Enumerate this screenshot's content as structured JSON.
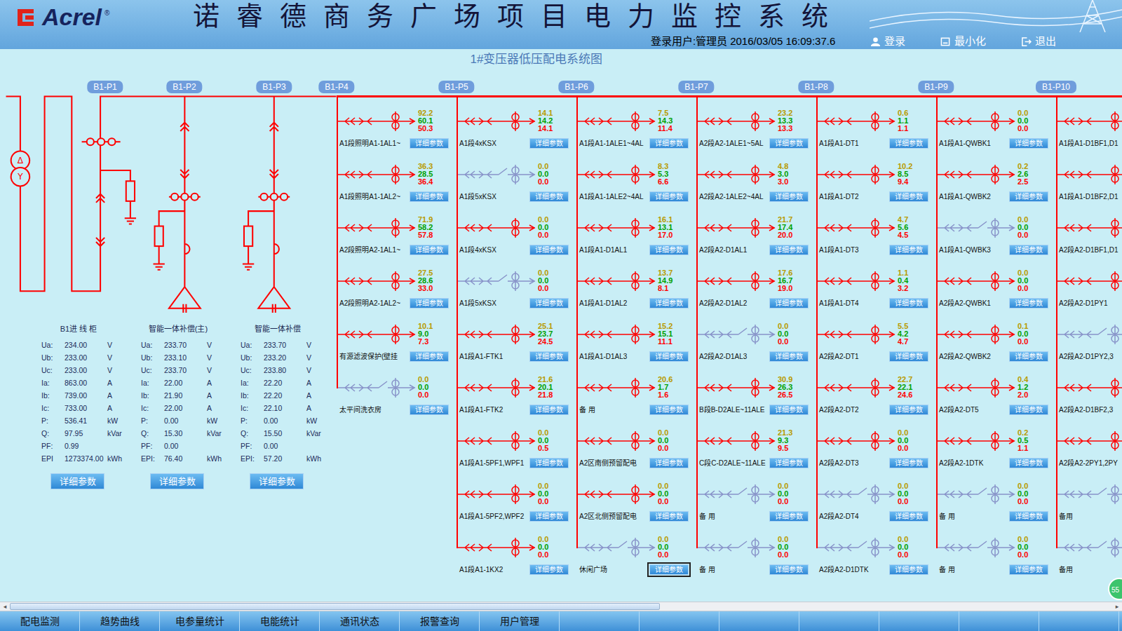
{
  "header": {
    "logo": "Acrel",
    "logo_mark": "®",
    "title": "诺睿德商务广场项目电力监控系统",
    "user": "登录用户:管理员",
    "time": "2016/03/05 16:09:37.6",
    "buttons": [
      {
        "label": "登录"
      },
      {
        "label": "最小化"
      },
      {
        "label": "退出"
      }
    ]
  },
  "diagram": {
    "title": "1#变压器低压配电系统图",
    "transformer": {
      "primary": "Δ",
      "secondary": "Y"
    },
    "cabinets": [
      {
        "tag": "B1-P1",
        "title": "B1进 线 柜",
        "params": [
          {
            "label": "Ua:",
            "value": "234.00",
            "unit": "V"
          },
          {
            "label": "Ub:",
            "value": "233.00",
            "unit": "V"
          },
          {
            "label": "Uc:",
            "value": "233.00",
            "unit": "V"
          },
          {
            "label": "Ia:",
            "value": "863.00",
            "unit": "A"
          },
          {
            "label": "Ib:",
            "value": "739.00",
            "unit": "A"
          },
          {
            "label": "Ic:",
            "value": "733.00",
            "unit": "A"
          },
          {
            "label": "P:",
            "value": "536.41",
            "unit": "kW"
          },
          {
            "label": "Q:",
            "value": "97.95",
            "unit": "kVar"
          },
          {
            "label": "PF:",
            "value": "0.99"
          },
          {
            "label": "EPI",
            "value": "1273374.00",
            "unit": "kWh"
          }
        ]
      },
      {
        "tag": "B1-P2",
        "title": "智能一体补偿(主)",
        "params": [
          {
            "label": "Ua:",
            "value": "233.70",
            "unit": "V"
          },
          {
            "label": "Ub:",
            "value": "233.10",
            "unit": "V"
          },
          {
            "label": "Uc:",
            "value": "233.70",
            "unit": "V"
          },
          {
            "label": "Ia:",
            "value": "22.00",
            "unit": "A"
          },
          {
            "label": "Ib:",
            "value": "21.90",
            "unit": "A"
          },
          {
            "label": "Ic:",
            "value": "22.00",
            "unit": "A"
          },
          {
            "label": "P:",
            "value": "0.00",
            "unit": "kW"
          },
          {
            "label": "Q:",
            "value": "15.30",
            "unit": "kVar"
          },
          {
            "label": "PF:",
            "value": "0.00"
          },
          {
            "label": "EPI:",
            "value": "76.40",
            "unit": "kWh"
          }
        ]
      },
      {
        "tag": "B1-P3",
        "title": "智能一体补偿",
        "params": [
          {
            "label": "Ua:",
            "value": "233.70",
            "unit": "V"
          },
          {
            "label": "Ub:",
            "value": "233.20",
            "unit": "V"
          },
          {
            "label": "Uc:",
            "value": "233.80",
            "unit": "V"
          },
          {
            "label": "Ia:",
            "value": "22.20",
            "unit": "A"
          },
          {
            "label": "Ib:",
            "value": "22.20",
            "unit": "A"
          },
          {
            "label": "Ic:",
            "value": "22.10",
            "unit": "A"
          },
          {
            "label": "P:",
            "value": "0.00",
            "unit": "kW"
          },
          {
            "label": "Q:",
            "value": "15.50",
            "unit": "kVar"
          },
          {
            "label": "PF:",
            "value": "0.00"
          },
          {
            "label": "EPI:",
            "value": "57.20",
            "unit": "kWh"
          }
        ]
      }
    ],
    "panels": [
      {
        "tag": "B1-P4",
        "feeders": [
          {
            "name": "A1段照明A1-1AL1~",
            "values": [
              "92.2",
              "60.1",
              "50.3"
            ],
            "on": true,
            "selected": false
          },
          {
            "name": "A1段照明A1-1AL2~",
            "values": [
              "36.3",
              "28.5",
              "36.4"
            ],
            "on": true,
            "selected": false
          },
          {
            "name": "A2段照明A2-1AL1~",
            "values": [
              "71.9",
              "58.2",
              "57.8"
            ],
            "on": true,
            "selected": false
          },
          {
            "name": "A2段照明A2-1AL2~",
            "values": [
              "27.5",
              "28.6",
              "33.0"
            ],
            "on": true,
            "selected": false
          },
          {
            "name": "有源滤波保护(壁挂",
            "values": [
              "10.1",
              "9.0",
              "7.3"
            ],
            "on": true,
            "selected": false
          },
          {
            "name": "太平间洗衣房",
            "values": [
              "0.0",
              "0.0",
              "0.0"
            ],
            "on": false,
            "selected": false
          }
        ]
      },
      {
        "tag": "B1-P5",
        "feeders": [
          {
            "name": "A1段4xKSX",
            "values": [
              "14.1",
              "14.2",
              "14.1"
            ],
            "on": true,
            "selected": false
          },
          {
            "name": "A1段5xKSX",
            "values": [
              "0.0",
              "0.0",
              "0.0"
            ],
            "on": false,
            "selected": false
          },
          {
            "name": "A1段4xKSX",
            "values": [
              "0.0",
              "0.0",
              "0.0"
            ],
            "on": true,
            "selected": false
          },
          {
            "name": "A1段5xKSX",
            "values": [
              "0.0",
              "0.0",
              "0.0"
            ],
            "on": false,
            "selected": false
          },
          {
            "name": "A1段A1-FTK1",
            "values": [
              "25.1",
              "23.7",
              "24.5"
            ],
            "on": true,
            "selected": false
          },
          {
            "name": "A1段A1-FTK2",
            "values": [
              "21.6",
              "20.1",
              "21.8"
            ],
            "on": true,
            "selected": false
          },
          {
            "name": "A1段A1-5PF1,WPF1",
            "values": [
              "0.0",
              "0.0",
              "0.5"
            ],
            "on": true,
            "selected": false
          },
          {
            "name": "A1段A1-5PF2,WPF2",
            "values": [
              "0.0",
              "0.0",
              "0.0"
            ],
            "on": true,
            "selected": false
          },
          {
            "name": "A1段A1-1KX2",
            "values": [
              "0.0",
              "0.0",
              "0.0"
            ],
            "on": true,
            "selected": false
          }
        ]
      },
      {
        "tag": "B1-P6",
        "feeders": [
          {
            "name": "A1段A1-1ALE1~4AL",
            "values": [
              "7.5",
              "14.3",
              "11.4"
            ],
            "on": true,
            "selected": false
          },
          {
            "name": "A1段A1-1ALE2~4AL",
            "values": [
              "8.3",
              "5.3",
              "6.6"
            ],
            "on": true,
            "selected": false
          },
          {
            "name": "A1段A1-D1AL1",
            "values": [
              "16.1",
              "13.1",
              "17.0"
            ],
            "on": true,
            "selected": false
          },
          {
            "name": "A1段A1-D1AL2",
            "values": [
              "13.7",
              "14.9",
              "8.1"
            ],
            "on": true,
            "selected": false
          },
          {
            "name": "A1段A1-D1AL3",
            "values": [
              "15.2",
              "15.1",
              "11.1"
            ],
            "on": true,
            "selected": false
          },
          {
            "name": "备 用",
            "values": [
              "20.6",
              "1.7",
              "1.6"
            ],
            "on": true,
            "selected": false
          },
          {
            "name": "A2区南侧预留配电",
            "values": [
              "0.0",
              "0.0",
              "0.0"
            ],
            "on": true,
            "selected": false
          },
          {
            "name": "A2区北侧预留配电",
            "values": [
              "0.0",
              "0.0",
              "0.0"
            ],
            "on": true,
            "selected": false
          },
          {
            "name": "休闲广场",
            "values": [
              "0.0",
              "0.0",
              "0.0"
            ],
            "on": false,
            "selected": true
          }
        ]
      },
      {
        "tag": "B1-P7",
        "feeders": [
          {
            "name": "A2段A2-1ALE1~5AL",
            "values": [
              "23.2",
              "13.3",
              "13.3"
            ],
            "on": true,
            "selected": false
          },
          {
            "name": "A2段A2-1ALE2~4AL",
            "values": [
              "4.8",
              "3.0",
              "3.0"
            ],
            "on": true,
            "selected": false
          },
          {
            "name": "A2段A2-D1AL1",
            "values": [
              "21.7",
              "17.4",
              "20.0"
            ],
            "on": true,
            "selected": false
          },
          {
            "name": "A2段A2-D1AL2",
            "values": [
              "17.6",
              "16.7",
              "19.0"
            ],
            "on": true,
            "selected": false
          },
          {
            "name": "A2段A2-D1AL3",
            "values": [
              "0.0",
              "0.0",
              "0.0"
            ],
            "on": false,
            "selected": false
          },
          {
            "name": "B段B-D2ALE~11ALE",
            "values": [
              "30.9",
              "26.3",
              "26.5"
            ],
            "on": true,
            "selected": false
          },
          {
            "name": "C段C-D2ALE~11ALE",
            "values": [
              "21.3",
              "9.3",
              "9.5"
            ],
            "on": true,
            "selected": false
          },
          {
            "name": "备 用",
            "values": [
              "0.0",
              "0.0",
              "0.0"
            ],
            "on": false,
            "selected": false
          },
          {
            "name": "备 用",
            "values": [
              "0.0",
              "0.0",
              "0.0"
            ],
            "on": false,
            "selected": false
          }
        ]
      },
      {
        "tag": "B1-P8",
        "feeders": [
          {
            "name": "A1段A1-DT1",
            "values": [
              "0.6",
              "1.1",
              "1.1"
            ],
            "on": true,
            "selected": false
          },
          {
            "name": "A1段A1-DT2",
            "values": [
              "10.2",
              "8.5",
              "9.4"
            ],
            "on": true,
            "selected": false
          },
          {
            "name": "A1段A1-DT3",
            "values": [
              "4.7",
              "5.6",
              "4.5"
            ],
            "on": true,
            "selected": false
          },
          {
            "name": "A1段A1-DT4",
            "values": [
              "1.1",
              "0.4",
              "3.2"
            ],
            "on": true,
            "selected": false
          },
          {
            "name": "A2段A2-DT1",
            "values": [
              "5.5",
              "4.2",
              "4.7"
            ],
            "on": true,
            "selected": false
          },
          {
            "name": "A2段A2-DT2",
            "values": [
              "22.7",
              "22.1",
              "24.6"
            ],
            "on": true,
            "selected": false
          },
          {
            "name": "A2段A2-DT3",
            "values": [
              "0.0",
              "0.0",
              "0.0"
            ],
            "on": true,
            "selected": false
          },
          {
            "name": "A2段A2-DT4",
            "values": [
              "0.0",
              "0.0",
              "0.0"
            ],
            "on": false,
            "selected": false
          },
          {
            "name": "A2段A2-D1DTK",
            "values": [
              "0.0",
              "0.0",
              "0.0"
            ],
            "on": false,
            "selected": false
          }
        ]
      },
      {
        "tag": "B1-P9",
        "feeders": [
          {
            "name": "A1段A1-QWBK1",
            "values": [
              "0.0",
              "0.0",
              "0.0"
            ],
            "on": true,
            "selected": false
          },
          {
            "name": "A1段A1-QWBK2",
            "values": [
              "0.2",
              "2.6",
              "2.5"
            ],
            "on": true,
            "selected": false
          },
          {
            "name": "A1段A1-QWBK3",
            "values": [
              "0.0",
              "0.0",
              "0.0"
            ],
            "on": false,
            "selected": false
          },
          {
            "name": "A2段A2-QWBK1",
            "values": [
              "0.0",
              "0.0",
              "0.0"
            ],
            "on": true,
            "selected": false
          },
          {
            "name": "A2段A2-QWBK2",
            "values": [
              "0.1",
              "0.0",
              "0.0"
            ],
            "on": true,
            "selected": false
          },
          {
            "name": "A2段A2-DT5",
            "values": [
              "0.4",
              "1.2",
              "2.0"
            ],
            "on": true,
            "selected": false
          },
          {
            "name": "A2段A2-1DTK",
            "values": [
              "0.2",
              "0.5",
              "1.1"
            ],
            "on": true,
            "selected": false
          },
          {
            "name": "备 用",
            "values": [
              "0.0",
              "0.0",
              "0.0"
            ],
            "on": false,
            "selected": false
          },
          {
            "name": "备 用",
            "values": [
              "0.0",
              "0.0",
              "0.0"
            ],
            "on": false,
            "selected": false
          }
        ]
      },
      {
        "tag": "B1-P10",
        "feeders": [
          {
            "name": "A1段A1-D1BF1,D1",
            "on": true,
            "selected": false
          },
          {
            "name": "A1段A1-D1BF2,D1",
            "on": true,
            "selected": false
          },
          {
            "name": "A2段A2-D1BF1,D1",
            "on": true,
            "selected": false
          },
          {
            "name": "A2段A2-D1PY1",
            "on": true,
            "selected": false
          },
          {
            "name": "A2段A2-D1PY2,3",
            "on": false,
            "selected": false
          },
          {
            "name": "A2段A2-D1BF2,3",
            "on": true,
            "selected": false
          },
          {
            "name": "A2段A2-2PY1,2PY",
            "on": true,
            "selected": false
          },
          {
            "name": "备用",
            "on": false,
            "selected": false
          },
          {
            "name": "备用",
            "on": false,
            "selected": false
          }
        ]
      }
    ]
  },
  "detail_button": "详细参数",
  "scrollbar": {
    "left": "◂",
    "right": "▸",
    "level": 0.59
  },
  "float_badge": "55",
  "nav": [
    {
      "label": "配电监测"
    },
    {
      "label": "趋势曲线"
    },
    {
      "label": "电参量统计"
    },
    {
      "label": "电能统计"
    },
    {
      "label": "通讯状态"
    },
    {
      "label": "报警查询"
    },
    {
      "label": "用户管理"
    }
  ]
}
